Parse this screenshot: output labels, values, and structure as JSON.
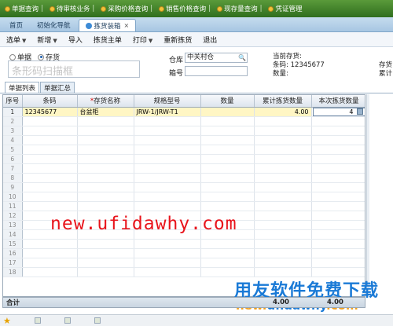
{
  "top_menu": [
    {
      "label": "单据查询"
    },
    {
      "label": "待审核业务"
    },
    {
      "label": "采购价格查询"
    },
    {
      "label": "销售价格查询"
    },
    {
      "label": "现存量查询"
    },
    {
      "label": "凭证管理"
    }
  ],
  "tabs": [
    {
      "label": "首页"
    },
    {
      "label": "初始化导航"
    },
    {
      "label": "拣货装箱"
    }
  ],
  "toolbar": {
    "select": "选单",
    "add": "新增",
    "import": "导入",
    "pick_doc": "拣货主单",
    "print": "打印",
    "re_pick": "重新拣货",
    "exit": "退出"
  },
  "form": {
    "radio_doc": "单据",
    "radio_stock": "存货",
    "radio_selected": "存货",
    "scan_placeholder": "条形码扫描框",
    "warehouse_label": "仓库",
    "warehouse_value": "中关村仓",
    "box_label": "箱号",
    "current_stock_label": "当前存货:",
    "barcode_label": "条码:",
    "barcode_value": "12345677",
    "qty_label": "数量:",
    "right_label_1": "存货",
    "right_label_2": "累计"
  },
  "subtabs": [
    "单据列表",
    "单据汇总"
  ],
  "table": {
    "columns": [
      "序号",
      "条码",
      "存货名称",
      "规格型号",
      "数量",
      "累计拣货数量",
      "本次拣货数量"
    ],
    "required_column": "存货名称",
    "rows": [
      {
        "no": "1",
        "barcode": "12345677",
        "name": "台盆柜",
        "spec": "JRW-1/JRW-T1",
        "qty": "",
        "cum": "4.00",
        "current": "4"
      },
      {
        "no": "2"
      },
      {
        "no": "3"
      },
      {
        "no": "4"
      },
      {
        "no": "5"
      },
      {
        "no": "6"
      },
      {
        "no": "7"
      },
      {
        "no": "8"
      },
      {
        "no": "9"
      },
      {
        "no": "10"
      },
      {
        "no": "11"
      },
      {
        "no": "12"
      },
      {
        "no": "13"
      },
      {
        "no": "14"
      },
      {
        "no": "15"
      },
      {
        "no": "16"
      },
      {
        "no": "17"
      },
      {
        "no": "18"
      }
    ]
  },
  "total": {
    "label": "合计",
    "cum": "4.00",
    "current": "4.00"
  },
  "watermark": "new.ufidawhy.com",
  "brand": {
    "name": "用友软件免费下载",
    "url_part1": "new.",
    "url_part2": "ufidawhy",
    "url_part3": ".com"
  }
}
